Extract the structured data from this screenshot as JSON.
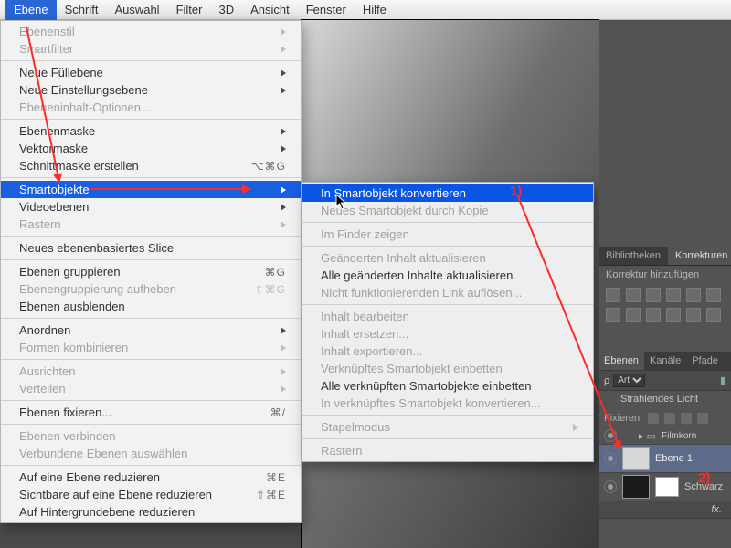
{
  "menubar": {
    "items": [
      "Ebene",
      "Schrift",
      "Auswahl",
      "Filter",
      "3D",
      "Ansicht",
      "Fenster",
      "Hilfe"
    ],
    "active": "Ebene"
  },
  "menu1": [
    {
      "label": "Ebenenstil",
      "disabled": true,
      "sub": true
    },
    {
      "label": "Smartfilter",
      "disabled": true,
      "sub": true
    },
    {
      "sep": true
    },
    {
      "label": "Neue Füllebene",
      "sub": true
    },
    {
      "label": "Neue Einstellungsebene",
      "sub": true
    },
    {
      "label": "Ebeneninhalt-Optionen...",
      "disabled": true
    },
    {
      "sep": true
    },
    {
      "label": "Ebenenmaske",
      "sub": true
    },
    {
      "label": "Vektormaske",
      "sub": true
    },
    {
      "label": "Schnittmaske erstellen",
      "shortcut": "⌥⌘G"
    },
    {
      "sep": true
    },
    {
      "label": "Smartobjekte",
      "sub": true,
      "hl": true
    },
    {
      "label": "Videoebenen",
      "sub": true
    },
    {
      "label": "Rastern",
      "sub": true,
      "disabled": true
    },
    {
      "sep": true
    },
    {
      "label": "Neues ebenenbasiertes Slice"
    },
    {
      "sep": true
    },
    {
      "label": "Ebenen gruppieren",
      "shortcut": "⌘G"
    },
    {
      "label": "Ebenengruppierung aufheben",
      "shortcut": "⇧⌘G",
      "disabled": true
    },
    {
      "label": "Ebenen ausblenden"
    },
    {
      "sep": true
    },
    {
      "label": "Anordnen",
      "sub": true
    },
    {
      "label": "Formen kombinieren",
      "sub": true,
      "disabled": true
    },
    {
      "sep": true
    },
    {
      "label": "Ausrichten",
      "sub": true,
      "disabled": true
    },
    {
      "label": "Verteilen",
      "sub": true,
      "disabled": true
    },
    {
      "sep": true
    },
    {
      "label": "Ebenen fixieren...",
      "shortcut": "⌘/"
    },
    {
      "sep": true
    },
    {
      "label": "Ebenen verbinden",
      "disabled": true
    },
    {
      "label": "Verbundene Ebenen auswählen",
      "disabled": true
    },
    {
      "sep": true
    },
    {
      "label": "Auf eine Ebene reduzieren",
      "shortcut": "⌘E"
    },
    {
      "label": "Sichtbare auf eine Ebene reduzieren",
      "shortcut": "⇧⌘E"
    },
    {
      "label": "Auf Hintergrundebene reduzieren"
    }
  ],
  "menu2": [
    {
      "label": "In Smartobjekt konvertieren",
      "hl": true
    },
    {
      "label": "Neues Smartobjekt durch Kopie",
      "disabled": true
    },
    {
      "sep": true
    },
    {
      "label": "Im Finder zeigen",
      "disabled": true
    },
    {
      "sep": true
    },
    {
      "label": "Geänderten Inhalt aktualisieren",
      "disabled": true
    },
    {
      "label": "Alle geänderten Inhalte aktualisieren"
    },
    {
      "label": "Nicht funktionierenden Link auflösen...",
      "disabled": true
    },
    {
      "sep": true
    },
    {
      "label": "Inhalt bearbeiten",
      "disabled": true
    },
    {
      "label": "Inhalt ersetzen...",
      "disabled": true
    },
    {
      "label": "Inhalt exportieren...",
      "disabled": true
    },
    {
      "label": "Verknüpftes Smartobjekt einbetten",
      "disabled": true
    },
    {
      "label": "Alle verknüpften Smartobjekte einbetten"
    },
    {
      "label": "In verknüpftes Smartobjekt konvertieren...",
      "disabled": true
    },
    {
      "sep": true
    },
    {
      "label": "Stapelmodus",
      "disabled": true,
      "sub": true
    },
    {
      "sep": true
    },
    {
      "label": "Rastern",
      "disabled": true
    }
  ],
  "right": {
    "tabs_top": [
      "Bibliotheken",
      "Korrekturen"
    ],
    "korrektur": "Korrektur hinzufügen",
    "tabs_layers": [
      "Ebenen",
      "Kanäle",
      "Pfade"
    ],
    "kind": "Art",
    "lock": "Fixieren:",
    "effect": "Strahlendes Licht",
    "layer1": "Ebene 1",
    "layer2": "Schwarz"
  },
  "ann": {
    "n1": "1)",
    "n2": "2)"
  }
}
